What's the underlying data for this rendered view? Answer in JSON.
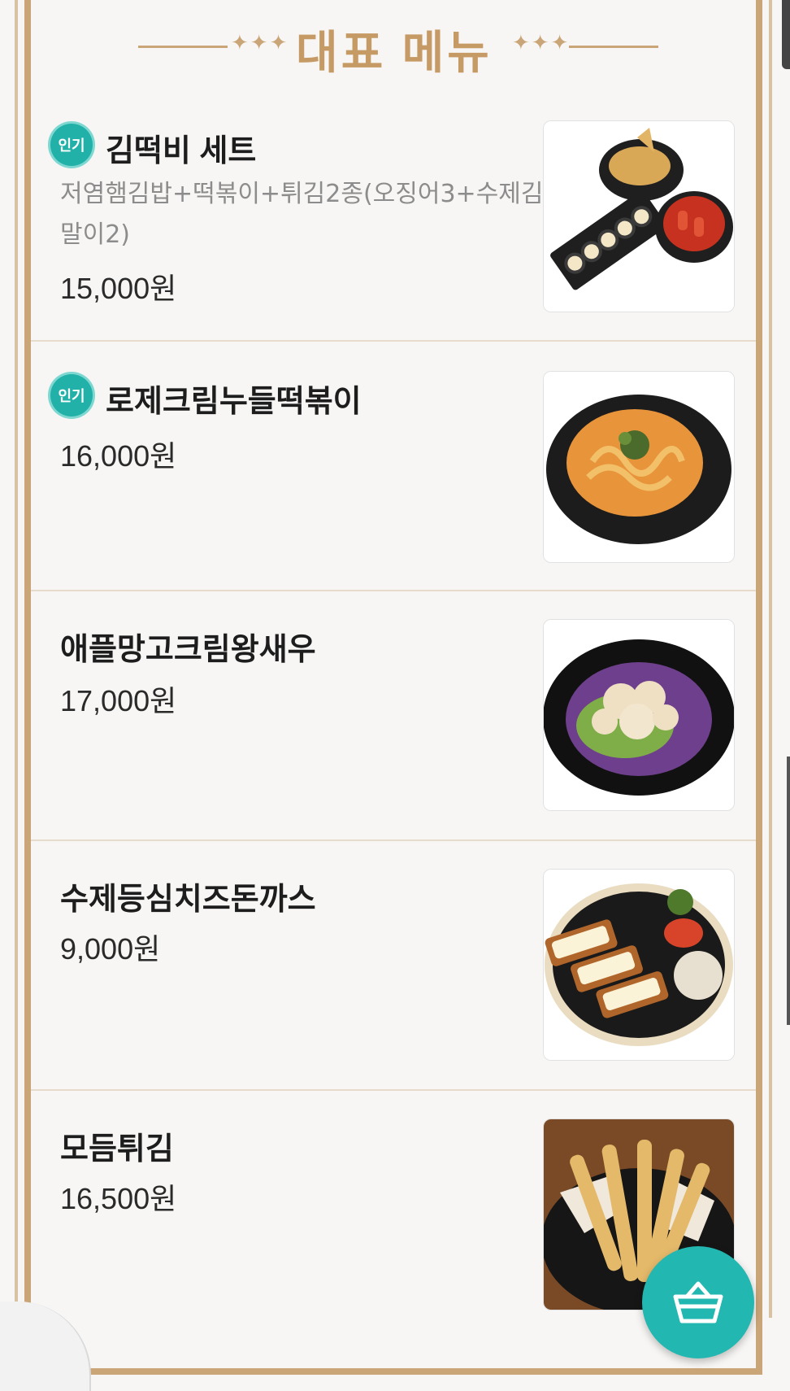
{
  "header": {
    "title": "대표 메뉴"
  },
  "badge_text": "인기",
  "menu": [
    {
      "name": "김떡비 세트",
      "popular": true,
      "description": "저염햄김밥+떡볶이+튀김2종(오징어3+수제김말이2)",
      "price": "15,000원",
      "image_icon": "gimbap-tteokbokki-tempura-set-image"
    },
    {
      "name": "로제크림누들떡볶이",
      "popular": true,
      "description": "",
      "price": "16,000원",
      "image_icon": "rose-cream-noodle-tteokbokki-image"
    },
    {
      "name": "애플망고크림왕새우",
      "popular": false,
      "description": "",
      "price": "17,000원",
      "image_icon": "apple-mango-cream-shrimp-image"
    },
    {
      "name": "수제등심치즈돈까스",
      "popular": false,
      "description": "",
      "price": "9,000원",
      "image_icon": "cheese-pork-cutlet-image"
    },
    {
      "name": "모듬튀김",
      "popular": false,
      "description": "",
      "price": "16,500원",
      "image_icon": "assorted-tempura-image"
    }
  ],
  "cart_button": {
    "icon": "shopping-basket-icon"
  },
  "colors": {
    "accent_gold": "#c69a64",
    "badge_teal": "#21b1a8",
    "cart_teal": "#23b7b1"
  }
}
